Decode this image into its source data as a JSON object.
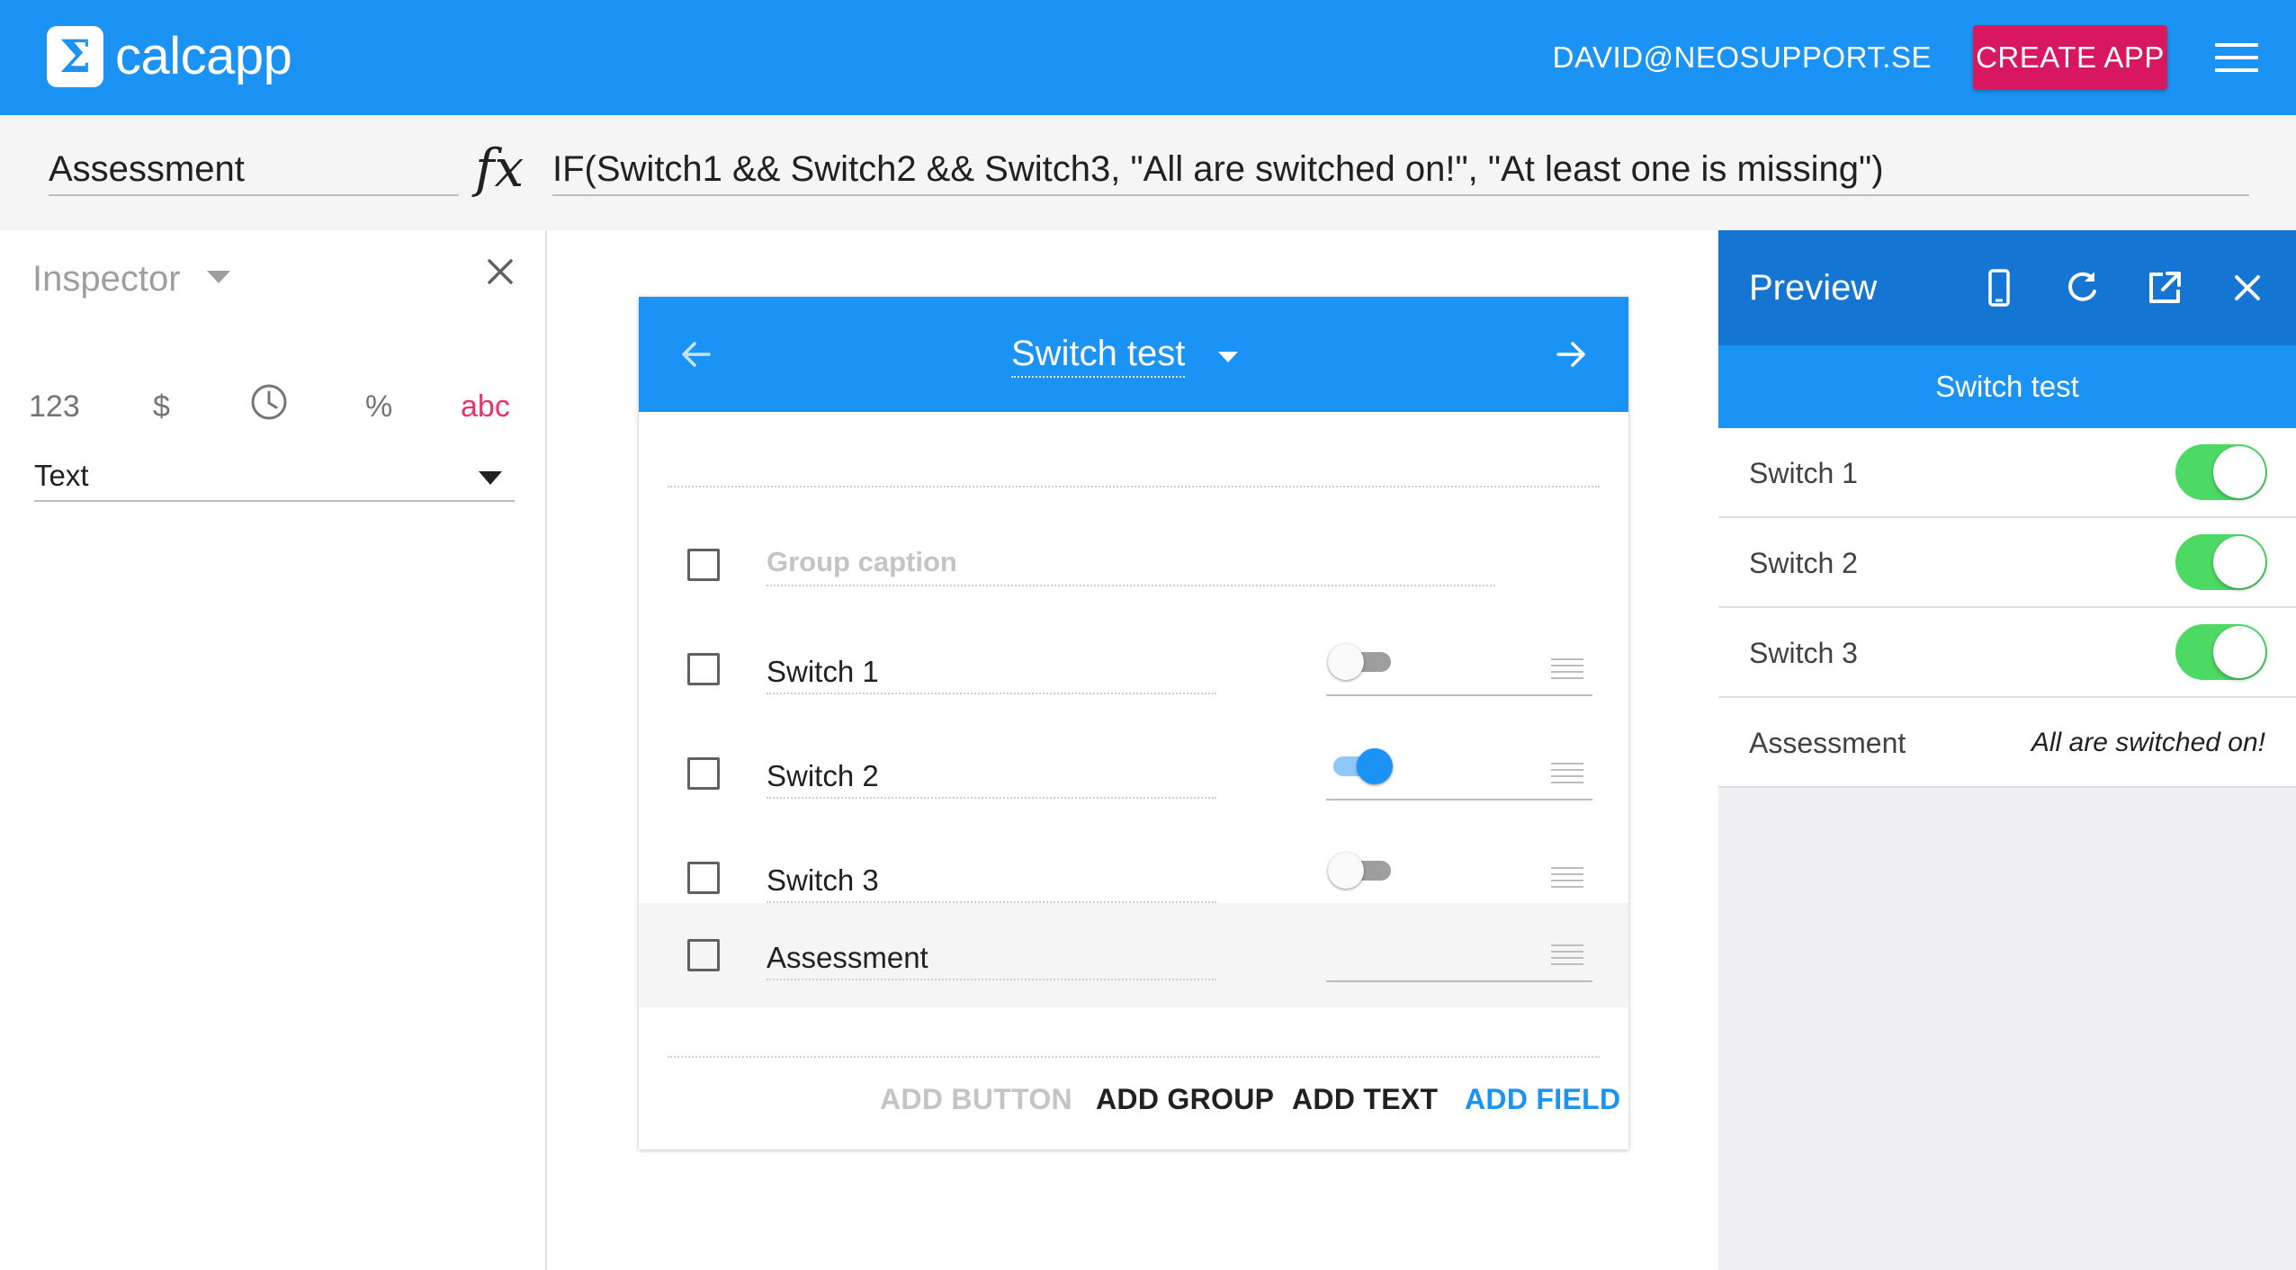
{
  "appbar": {
    "logo_glyph": "Σ",
    "brand": "calcapp",
    "user_email": "DAVID@NEOSUPPORT.SE",
    "create_app_label": "CREATE APP",
    "menu_icon": "hamburger-menu-icon",
    "bg_color": "#1b93f4",
    "accent_color": "#d8175f"
  },
  "formula_bar": {
    "field_name": "Assessment",
    "fx_label": "fx",
    "formula": "IF(Switch1 && Switch2 && Switch3, \"All are switched on!\", \"At least one is missing\")"
  },
  "inspector": {
    "title": "Inspector",
    "type_options": [
      {
        "label": "123",
        "active": false
      },
      {
        "label": "$",
        "active": false
      },
      {
        "label": "clock-icon",
        "active": false
      },
      {
        "label": "%",
        "active": false
      },
      {
        "label": "abc",
        "active": true
      }
    ],
    "format_value": "Text",
    "active_color": "#e8336c"
  },
  "canvas": {
    "screen_title": "Switch test",
    "group_caption_placeholder": "Group caption",
    "fields": [
      {
        "label": "Switch 1",
        "kind": "switch",
        "on": false
      },
      {
        "label": "Switch 2",
        "kind": "switch",
        "on": true
      },
      {
        "label": "Switch 3",
        "kind": "switch",
        "on": false
      },
      {
        "label": "Assessment",
        "kind": "text",
        "selected": true
      }
    ],
    "actions": {
      "add_button": "ADD BUTTON",
      "add_group": "ADD GROUP",
      "add_text": "ADD TEXT",
      "add_field": "ADD FIELD"
    }
  },
  "preview": {
    "title": "Preview",
    "screen_title": "Switch test",
    "rows": [
      {
        "label": "Switch 1",
        "on": true
      },
      {
        "label": "Switch 2",
        "on": true
      },
      {
        "label": "Switch 3",
        "on": true
      }
    ],
    "result": {
      "label": "Assessment",
      "value": "All are switched on!"
    },
    "switch_color": "#4cd964"
  }
}
